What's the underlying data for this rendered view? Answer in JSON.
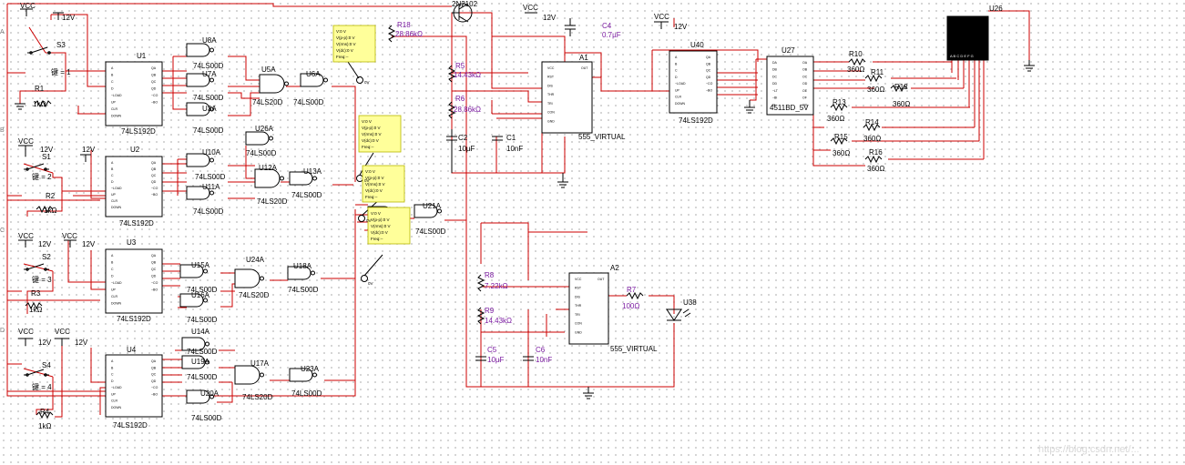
{
  "parts": {
    "u1": "U1",
    "u2": "U2",
    "u3": "U3",
    "u4": "U4",
    "chip_192": "74LS192D",
    "u40": "U40",
    "u27": "U27",
    "decoder": "4511BD_5V",
    "u26": "U26",
    "a1": "A1",
    "a2": "A2",
    "timer": "555_VIRTUAL",
    "transistor": "2N2102",
    "led": "U38"
  },
  "gates": {
    "nand": "74LS00D",
    "nand4": "74LS20D",
    "u8a": "U8A",
    "u7a": "U7A",
    "u3a": "U3A",
    "u5a": "U5A",
    "u6a": "U6A",
    "u26a": "U26A",
    "u10a": "U10A",
    "u11a": "U11A",
    "u12a": "U12A",
    "u13a": "U13A",
    "u21a": "U21A",
    "u15a": "U15A",
    "u16a": "U16A",
    "u24a": "U24A",
    "u18a": "U18A",
    "u14a": "U14A",
    "u19a": "U19A",
    "u20a": "U20A",
    "u17a": "U17A",
    "u23a": "U23A"
  },
  "passives": {
    "r1": "R1",
    "r2": "R2",
    "r3": "R3",
    "r4": "R4",
    "r_1k": "1kΩ",
    "r18": "R18",
    "r18_val": "28.86kΩ",
    "r5": "R5",
    "r5_val": "14.43kΩ",
    "r6": "R6",
    "r6_val": "28.86kΩ",
    "c4": "C4",
    "c4_val": "0.7µF",
    "c2": "C2",
    "c2_val": "10µF",
    "c1": "C1",
    "c1_val": "10nF",
    "r8": "R8",
    "r8_val": "7.22kΩ",
    "r9": "R9",
    "r9_val": "14.43kΩ",
    "c5": "C5",
    "c5_val": "10µF",
    "c6": "C6",
    "c6_val": "10nF",
    "r7": "R7",
    "r7_val": "100Ω",
    "r10": "R10",
    "r11": "R11",
    "r12": "R12",
    "r13": "R13",
    "r14": "R14",
    "r15": "R15",
    "r16": "R16",
    "r_360": "360Ω"
  },
  "switches": {
    "s3": "S3",
    "s3_key": "键 = 1",
    "s1": "S1",
    "s1_key": "键 = 2",
    "s2": "S2",
    "s2_key": "键 = 3",
    "s4": "S4",
    "s4_key": "键 = 4"
  },
  "power": {
    "vcc": "VCC",
    "v12": "12V"
  },
  "probe": {
    "lines": [
      "V:0 V",
      "V(p-p):0 V",
      "V(rms):0 V",
      "V(dc):0 V",
      "Freq:--"
    ],
    "tag": "0V"
  },
  "pins_192": [
    "A",
    "B",
    "C",
    "D",
    "~LOAD",
    "UP",
    "CLR",
    "DOWN",
    "QA",
    "QB",
    "QC",
    "QD",
    "~CO",
    "~BO"
  ],
  "pins_4511": [
    "DA",
    "DB",
    "DC",
    "DD",
    "~LT",
    "~BI",
    "EL",
    "OA",
    "OB",
    "OC",
    "OD",
    "OE",
    "OF",
    "OG"
  ],
  "pins_555": [
    "VCC",
    "RST",
    "DIS",
    "THR",
    "TRI",
    "CON",
    "GND",
    "OUT"
  ],
  "display_pins": "A B C D E F G",
  "tabs": [
    "A",
    "B",
    "C",
    "D"
  ],
  "watermark": "https://blog.csdn.net/..."
}
